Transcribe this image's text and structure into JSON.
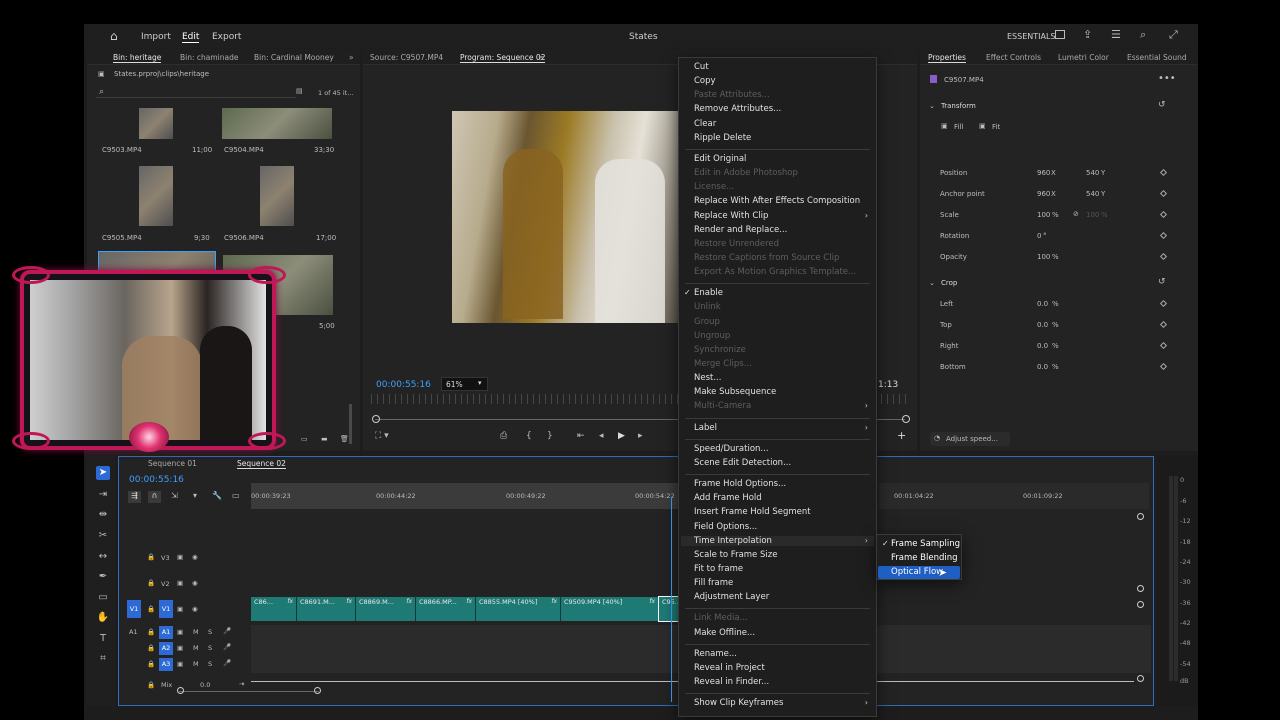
{
  "topbar": {
    "nav": [
      "Import",
      "Edit",
      "Export"
    ],
    "active_nav": "Edit",
    "title": "States",
    "workspace": "ESSENTIALS"
  },
  "project": {
    "tabs": [
      "Bin: heritage",
      "Bin: chaminade",
      "Bin: Cardinal Mooney"
    ],
    "path": "States.prproj\\clips\\heritage",
    "count": "1 of 45 it...",
    "clips": [
      {
        "name": "C9503.MP4",
        "dur": "11;00"
      },
      {
        "name": "C9504.MP4",
        "dur": "33;30"
      },
      {
        "name": "C9505.MP4",
        "dur": "9;30"
      },
      {
        "name": "C9506.MP4",
        "dur": "17;00"
      },
      {
        "name": "",
        "dur": "5;00"
      }
    ]
  },
  "source_tab": "Source: C9507.MP4",
  "program": {
    "tab": "Program: Sequence 02",
    "timecode": "00:00:55:16",
    "zoom": "61%",
    "end_tc": "1:13"
  },
  "properties": {
    "tabs": [
      "Properties",
      "Effect Controls",
      "Lumetri Color",
      "Essential Sound"
    ],
    "clip": "C9507.MP4",
    "transform": "Transform",
    "fill": "Fill",
    "fit": "Fit",
    "rows": [
      {
        "label": "Position",
        "v1": "960",
        "u1": "X",
        "v2": "540",
        "u2": "Y"
      },
      {
        "label": "Anchor point",
        "v1": "960",
        "u1": "X",
        "v2": "540",
        "u2": "Y"
      },
      {
        "label": "Scale",
        "v1": "100",
        "u1": "%",
        "v2": "100",
        "u2": "%"
      },
      {
        "label": "Rotation",
        "v1": "0",
        "u1": "°",
        "v2": "",
        "u2": ""
      },
      {
        "label": "Opacity",
        "v1": "100",
        "u1": "%",
        "v2": "",
        "u2": ""
      }
    ],
    "crop": "Crop",
    "crop_rows": [
      {
        "label": "Left",
        "v": "0.0",
        "u": "%"
      },
      {
        "label": "Top",
        "v": "0.0",
        "u": "%"
      },
      {
        "label": "Right",
        "v": "0.0",
        "u": "%"
      },
      {
        "label": "Bottom",
        "v": "0.0",
        "u": "%"
      }
    ],
    "adjust_speed": "Adjust speed..."
  },
  "timeline": {
    "tabs": [
      "Sequence 01",
      "Sequence 02"
    ],
    "timecode": "00:00:55:16",
    "ruler": [
      "00:00:39:23",
      "00:00:44:22",
      "00:00:49:22",
      "00:00:54:22",
      "00:01:04:22",
      "00:01:09:22"
    ],
    "tracks": [
      "V3",
      "V2",
      "V1",
      "A1",
      "A2",
      "A3"
    ],
    "mix_label": "Mix",
    "mix_value": "0.0",
    "clips": [
      "C86...",
      "C8691.M...",
      "C8869.M...",
      "C8866.MP...",
      "C8855.MP4 [40%]",
      "C9509.MP4 [40%]",
      "C95..."
    ],
    "fx": "fx"
  },
  "meter": {
    "labels": [
      "0",
      "-6",
      "-12",
      "-18",
      "-24",
      "-30",
      "-36",
      "-42",
      "-48",
      "-54",
      "dB"
    ]
  },
  "context_menu": {
    "items": [
      {
        "label": "Cut",
        "disabled": false
      },
      {
        "label": "Copy",
        "disabled": false
      },
      {
        "label": "Paste Attributes...",
        "disabled": true
      },
      {
        "label": "Remove Attributes...",
        "disabled": false
      },
      {
        "label": "Clear",
        "disabled": false
      },
      {
        "label": "Ripple Delete",
        "disabled": false
      },
      {
        "label": "Edit Original",
        "disabled": false
      },
      {
        "label": "Edit in Adobe Photoshop",
        "disabled": true
      },
      {
        "label": "License...",
        "disabled": true
      },
      {
        "label": "Replace With After Effects Composition",
        "disabled": false
      },
      {
        "label": "Replace With Clip",
        "disabled": false,
        "submenu": true
      },
      {
        "label": "Render and Replace...",
        "disabled": false
      },
      {
        "label": "Restore Unrendered",
        "disabled": true
      },
      {
        "label": "Restore Captions from Source Clip",
        "disabled": true
      },
      {
        "label": "Export As Motion Graphics Template...",
        "disabled": true
      },
      {
        "label": "Enable",
        "disabled": false,
        "checked": true
      },
      {
        "label": "Unlink",
        "disabled": true
      },
      {
        "label": "Group",
        "disabled": true
      },
      {
        "label": "Ungroup",
        "disabled": true
      },
      {
        "label": "Synchronize",
        "disabled": true
      },
      {
        "label": "Merge Clips...",
        "disabled": true
      },
      {
        "label": "Nest...",
        "disabled": false
      },
      {
        "label": "Make Subsequence",
        "disabled": false
      },
      {
        "label": "Multi-Camera",
        "disabled": true,
        "submenu": true
      },
      {
        "label": "Label",
        "disabled": false,
        "submenu": true
      },
      {
        "label": "Speed/Duration...",
        "disabled": false
      },
      {
        "label": "Scene Edit Detection...",
        "disabled": false
      },
      {
        "label": "Frame Hold Options...",
        "disabled": false
      },
      {
        "label": "Add Frame Hold",
        "disabled": false
      },
      {
        "label": "Insert Frame Hold Segment",
        "disabled": false
      },
      {
        "label": "Field Options...",
        "disabled": false
      },
      {
        "label": "Time Interpolation",
        "disabled": false,
        "submenu": true,
        "highlight": true
      },
      {
        "label": "Scale to Frame Size",
        "disabled": false
      },
      {
        "label": "Fit to frame",
        "disabled": false
      },
      {
        "label": "Fill frame",
        "disabled": false
      },
      {
        "label": "Adjustment Layer",
        "disabled": false
      },
      {
        "label": "Link Media...",
        "disabled": true
      },
      {
        "label": "Make Offline...",
        "disabled": false
      },
      {
        "label": "Rename...",
        "disabled": false
      },
      {
        "label": "Reveal in Project",
        "disabled": false
      },
      {
        "label": "Reveal in Finder...",
        "disabled": false
      },
      {
        "label": "Show Clip Keyframes",
        "disabled": false,
        "submenu": true
      }
    ]
  },
  "submenu": {
    "items": [
      {
        "label": "Frame Sampling",
        "checked": true
      },
      {
        "label": "Frame Blending",
        "checked": false
      },
      {
        "label": "Optical Flow",
        "checked": false,
        "selected": true
      }
    ]
  },
  "colors": {
    "accent": "#3fa0ff",
    "clip_teal": "#1d7a74",
    "menu_highlight": "#1f5fc4",
    "overlay_frame": "#c01856"
  }
}
